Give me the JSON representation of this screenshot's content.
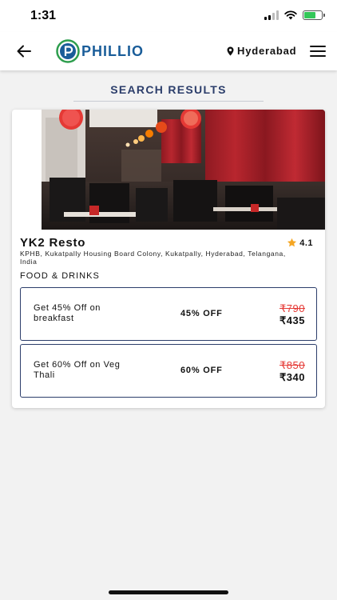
{
  "status_bar": {
    "time": "1:31"
  },
  "header": {
    "logo_text": "PHILLIO",
    "location": "Hyderabad"
  },
  "section_title": "SEARCH RESULTS",
  "results": [
    {
      "name": "YK2 Resto",
      "rating": "4.1",
      "address": "KPHB, Kukatpally Housing Board Colony, Kukatpally, Hyderabad, Telangana, India",
      "category": "FOOD & DRINKS",
      "offers": [
        {
          "description": "Get 45% Off on breakfast",
          "discount": "45% OFF",
          "original_price": "₹790",
          "final_price": "₹435"
        },
        {
          "description": "Get 60% Off on Veg Thali",
          "discount": "60% OFF",
          "original_price": "₹850",
          "final_price": "₹340"
        }
      ]
    }
  ],
  "colors": {
    "brand_blue": "#1a5d99",
    "brand_green": "#2e9e4e",
    "accent_navy": "#2c3e6b",
    "strike_red": "#e53935",
    "star_orange": "#f5a623"
  },
  "icons": [
    "back-arrow-icon",
    "location-pin-icon",
    "hamburger-menu-icon",
    "star-icon",
    "signal-icon",
    "wifi-icon",
    "battery-icon"
  ]
}
